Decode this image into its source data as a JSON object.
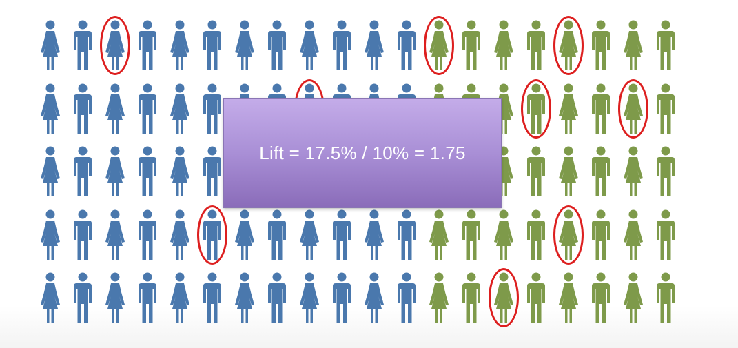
{
  "slide": {
    "lift_text": "Lift = 17.5% / 10% = 1.75"
  },
  "colors": {
    "blue_figure": "#4a78ad",
    "green_figure": "#7e9a4a",
    "highlight_circle": "#dd1f1f",
    "box_top": "#c4ace9",
    "box_bottom": "#8a6cb9"
  },
  "people_grid": {
    "rows": 5,
    "columns": 20,
    "blue_columns": 12,
    "green_columns": 8,
    "pattern": [
      [
        "f",
        "m",
        "f",
        "m",
        "f",
        "m",
        "f",
        "m",
        "f",
        "m",
        "f",
        "m",
        "f",
        "m",
        "f",
        "m",
        "f",
        "m",
        "f",
        "m"
      ],
      [
        "f",
        "m",
        "f",
        "m",
        "f",
        "m",
        "f",
        "m",
        "f",
        "m",
        "f",
        "m",
        "f",
        "m",
        "f",
        "m",
        "f",
        "m",
        "f",
        "m"
      ],
      [
        "f",
        "m",
        "f",
        "m",
        "f",
        "m",
        "f",
        "m",
        "f",
        "m",
        "f",
        "m",
        "f",
        "m",
        "f",
        "m",
        "f",
        "m",
        "f",
        "m"
      ],
      [
        "f",
        "m",
        "f",
        "m",
        "f",
        "m",
        "f",
        "m",
        "f",
        "m",
        "f",
        "m",
        "f",
        "m",
        "f",
        "m",
        "f",
        "m",
        "f",
        "m"
      ],
      [
        "f",
        "m",
        "f",
        "m",
        "f",
        "m",
        "f",
        "m",
        "f",
        "m",
        "f",
        "m",
        "f",
        "m",
        "f",
        "m",
        "f",
        "m",
        "f",
        "m"
      ]
    ],
    "circled": [
      [
        0,
        2
      ],
      [
        0,
        12
      ],
      [
        0,
        16
      ],
      [
        1,
        8
      ],
      [
        1,
        15
      ],
      [
        1,
        18
      ],
      [
        3,
        5
      ],
      [
        3,
        16
      ],
      [
        4,
        14
      ]
    ]
  }
}
